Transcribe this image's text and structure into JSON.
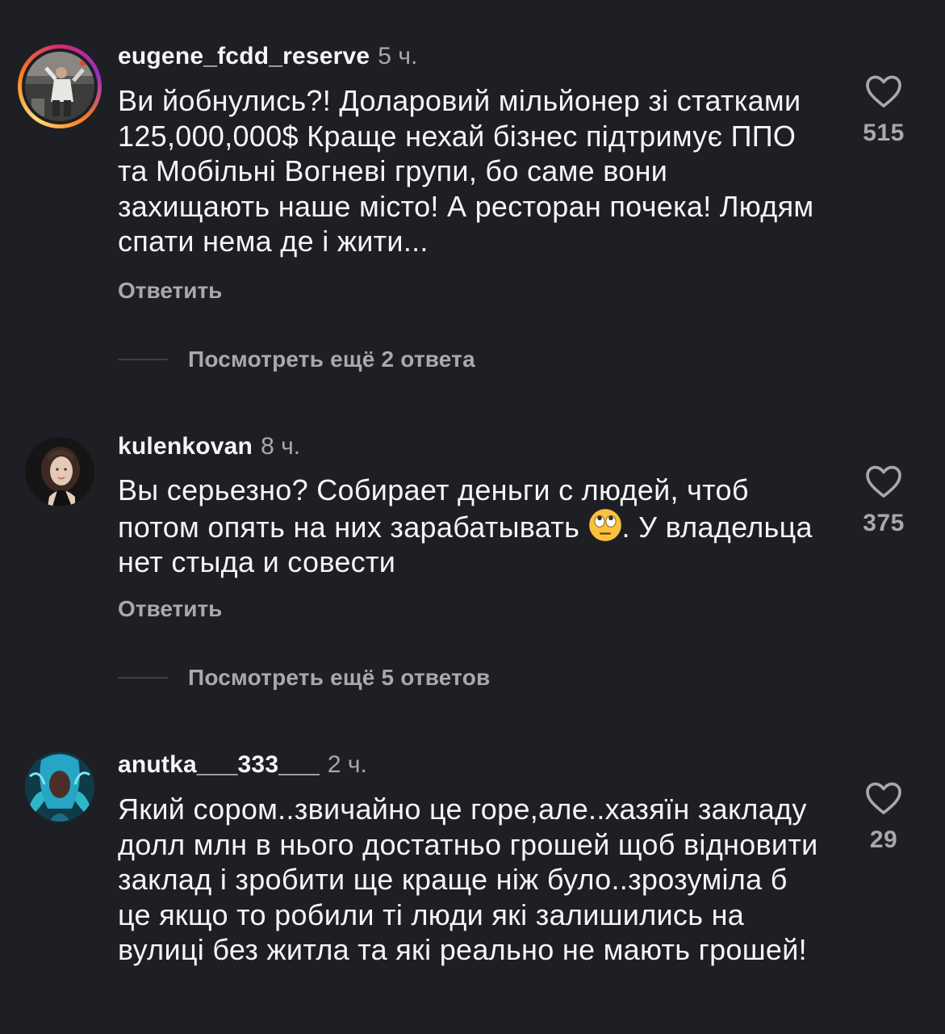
{
  "comments": [
    {
      "username": "eugene_fcdd_reserve",
      "time": "5 ч.",
      "text": "Ви йобнулись?! Доларовий мільйонер зі статками 125,000,000$ Краще нехай бізнес підтримує ППО та Мобільні Вогневі групи, бо саме вони захищають наше місто! А ресторан почека! Людям спати нема де і жити...",
      "reply_label": "Ответить",
      "more_replies": "Посмотреть ещё 2 ответа",
      "likes": "515",
      "has_story_ring": true
    },
    {
      "username": "kulenkovan",
      "time": "8 ч.",
      "text_before_emoji": "Вы серьезно? Собирает деньги с людей, чтоб потом опять на них зарабатывать ",
      "emoji": "face-with-rolling-eyes",
      "text_after_emoji": ". У владельца нет стыда и совести",
      "reply_label": "Ответить",
      "more_replies": "Посмотреть ещё 5 ответов",
      "likes": "375",
      "has_story_ring": false
    },
    {
      "username": "anutka___333___",
      "time": "2 ч.",
      "text": "Який сором..звичайно це горе,але..хазяїн закладу долл млн в нього достатньо грошей щоб відновити заклад і зробити ще краще ніж було..зрозуміла б це якщо то робили ті люди які залишились на вулиці без житла та які реально не мають грошей!",
      "likes": "29",
      "has_story_ring": false
    }
  ],
  "colors": {
    "background": "#1e1f24",
    "text_primary": "#f5f5f5",
    "text_secondary": "#a8a8ae"
  }
}
